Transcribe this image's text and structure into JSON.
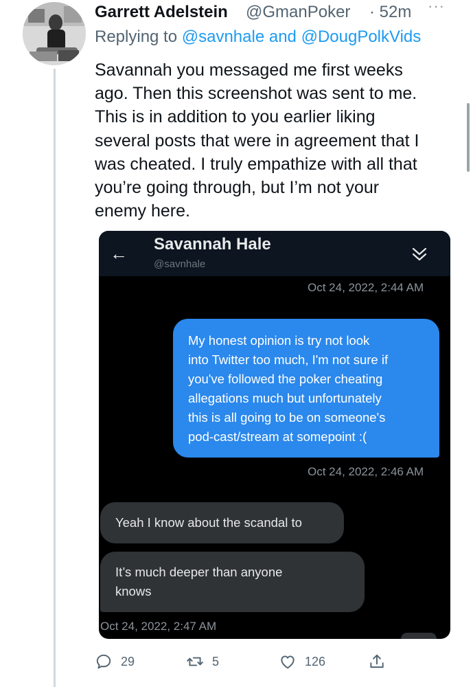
{
  "tweet": {
    "author_name": "Garrett Adelstein",
    "author_handle": "@GmanPoker",
    "time": "· 52m",
    "more_icon": "more-horizontal-icon",
    "replying_prefix": "Replying to",
    "replying_to_1": "@savnhale",
    "replying_and": "and",
    "replying_to_2": "@DougPolkVids",
    "body_lines": [
      "Savannah you messaged me first weeks",
      "ago. Then this screenshot was sent to me.",
      "This is in addition to you earlier liking",
      "several posts that were in agreement that I",
      "was cheated. I truly empathize with all that",
      "you’re going through, but I’m not your",
      "enemy here."
    ]
  },
  "screenshot": {
    "header": {
      "name": "Savannah Hale",
      "handle": "@savnhale",
      "back_icon": "back-arrow-icon",
      "collapse_icon": "double-chevron-down-icon"
    },
    "stamp_1": "Oct 24, 2022, 2:44 AM",
    "outgoing_lines": [
      "My honest opinion is try not look",
      "into Twitter too much, I'm not sure if",
      "you've followed the poker cheating",
      "allegations much but unfortunately",
      "this is all going to be on someone's",
      "pod-cast/stream at somepoint :("
    ],
    "stamp_2": "Oct 24, 2022, 2:46 AM",
    "incoming_1": "Yeah I know about the scandal to",
    "incoming_2_lines": [
      "It’s much deeper than anyone",
      "knows"
    ],
    "stamp_3": "Oct 24, 2022, 2:47 AM"
  },
  "actions": {
    "reply_count": "29",
    "retweet_count": "5",
    "like_count": "126",
    "icons": [
      "reply-icon",
      "retweet-icon",
      "like-icon",
      "share-icon"
    ]
  },
  "colors": {
    "accent": "#1d9bf0",
    "secondary_text": "#536471",
    "dm_outgoing": "#2b88ec",
    "dm_incoming": "#2f3336"
  }
}
